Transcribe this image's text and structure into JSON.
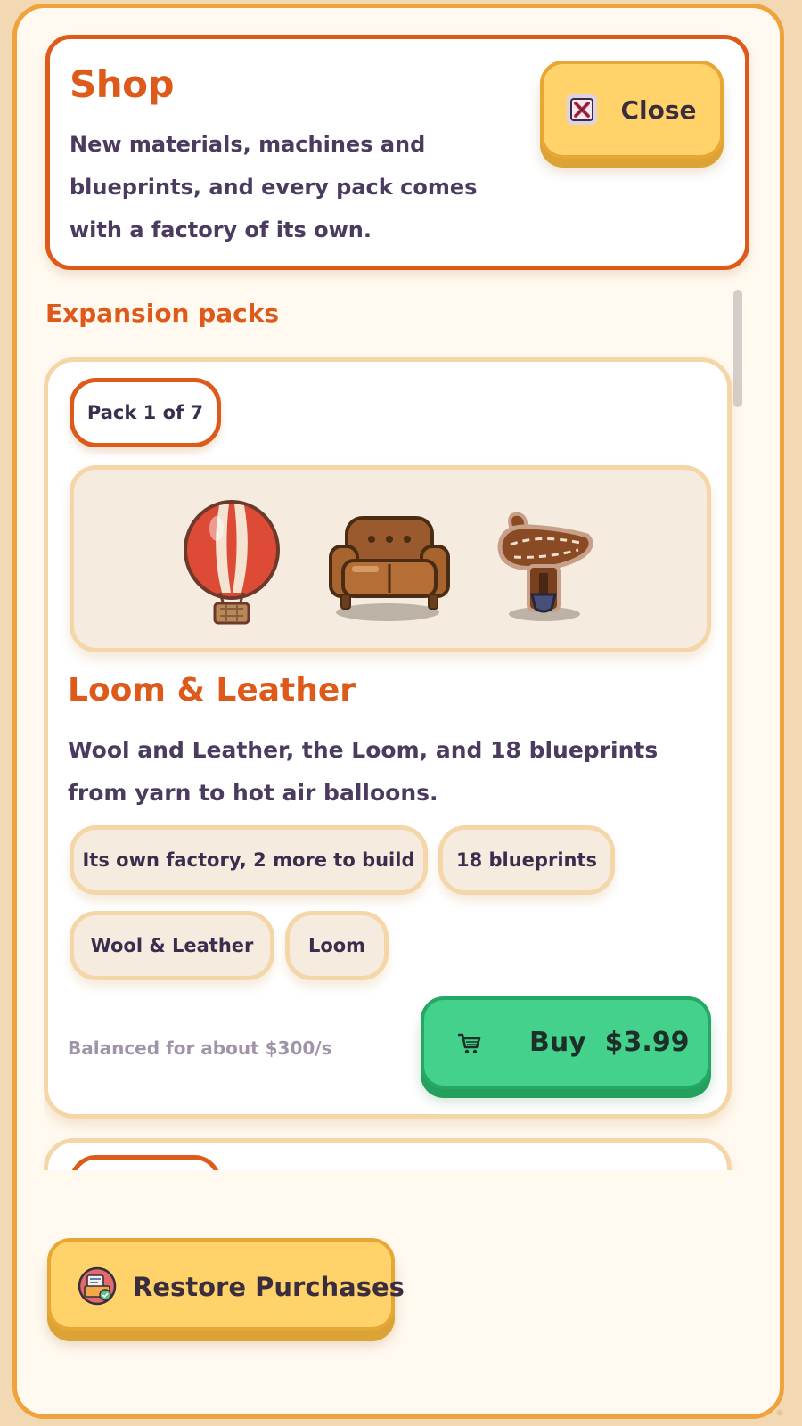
{
  "header": {
    "title": "Shop",
    "description": "New materials, machines and blueprints, and every pack comes with a factory of its own.",
    "close_label": "Close",
    "close_icon": "close-icon"
  },
  "section": {
    "title": "Expansion packs"
  },
  "pack": {
    "badge": "Pack 1 of 7",
    "preview_icons": [
      "hot-air-balloon-icon",
      "leather-sofa-icon",
      "saddle-icon"
    ],
    "name": "Loom & Leather",
    "description": "Wool and Leather, the Loom, and 18 blueprints from yarn to hot air balloons.",
    "tags": [
      "Its own factory, 2 more to build",
      "18 blueprints",
      "Wool & Leather",
      "Loom"
    ],
    "balance_note": "Balanced for about $300/s",
    "buy_label": "Buy  $3.99",
    "buy_icon": "cart-icon"
  },
  "footer": {
    "restore_label": "Restore Purchases",
    "restore_icon": "receipt-icon"
  },
  "colors": {
    "accent": "#dd5a1b",
    "panel_border": "#f0a23c",
    "button_yellow": "#ffd36a",
    "button_green": "#43d18c",
    "text_dark": "#4b3b5e",
    "text_muted": "#a193a8"
  }
}
